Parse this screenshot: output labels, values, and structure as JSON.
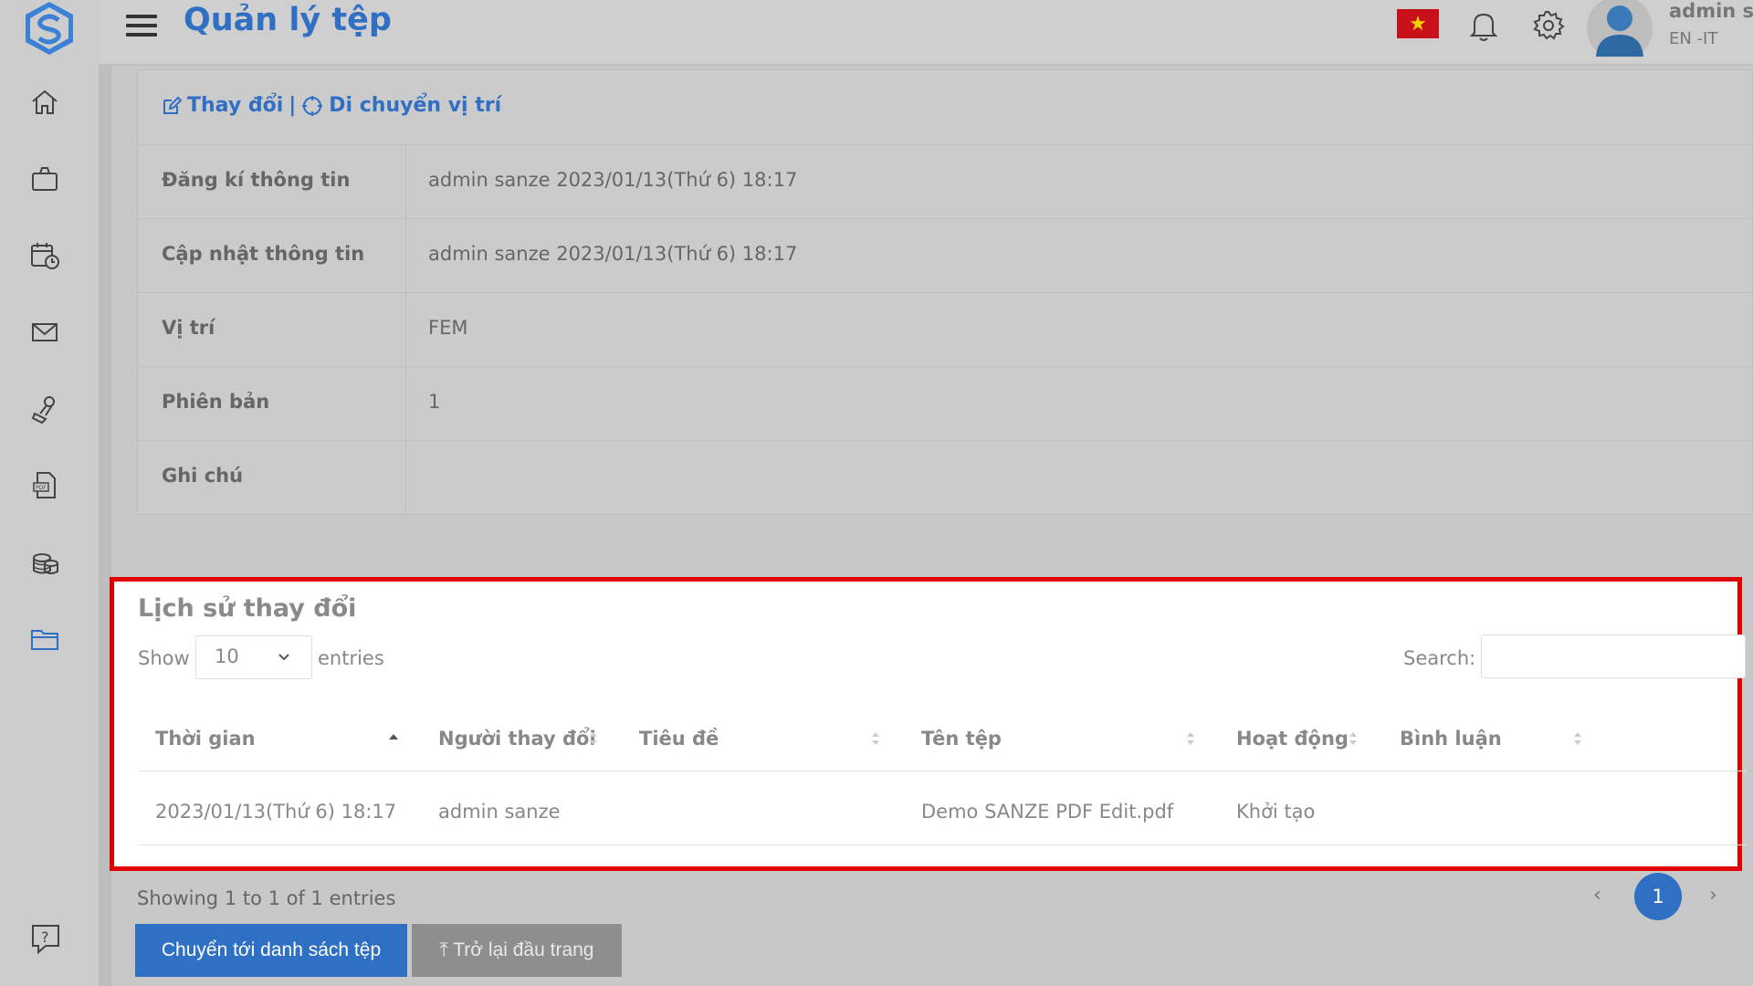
{
  "header": {
    "title": "Quản lý tệp",
    "user_name": "admin sanze",
    "language": "EN -IT",
    "flag_star": "★"
  },
  "sidebar": {
    "items": [
      "home",
      "briefcase",
      "calendar-clock",
      "mail",
      "stamp",
      "pdf-file",
      "coins",
      "folder"
    ]
  },
  "info": {
    "actions": {
      "edit": "Thay đổi",
      "separator": "|",
      "move": "Di chuyển vị trí"
    },
    "rows": [
      {
        "label": "Đăng kí thông tin",
        "value": "admin sanze 2023/01/13(Thứ 6) 18:17"
      },
      {
        "label": "Cập nhật thông tin",
        "value": "admin sanze 2023/01/13(Thứ 6) 18:17"
      },
      {
        "label": "Vị trí",
        "value": "FEM"
      },
      {
        "label": "Phiên bản",
        "value": "1"
      },
      {
        "label": "Ghi chú",
        "value": ""
      }
    ]
  },
  "history": {
    "title": "Lịch sử thay đổi",
    "show_label": "Show",
    "page_length": "10",
    "entries_label": "entries",
    "search_label": "Search:",
    "columns": [
      "Thời gian",
      "Người thay đổi",
      "Tiêu đề",
      "Tên tệp",
      "Hoạt động",
      "Bình luận"
    ],
    "rows": [
      [
        "2023/01/13(Thứ 6) 18:17",
        "admin sanze",
        "",
        "Demo SANZE PDF Edit.pdf",
        "Khởi tạo",
        ""
      ]
    ]
  },
  "footer": {
    "showing": "Showing 1 to 1 of 1 entries",
    "prev": "‹",
    "next": "›",
    "current_page": "1",
    "go_list_button": "Chuyển tới danh sách tệp",
    "back_top_button": "⤒ Trở lại đầu trang"
  },
  "colors": {
    "accent": "#2f6fc4",
    "highlight_border": "#e00000"
  }
}
